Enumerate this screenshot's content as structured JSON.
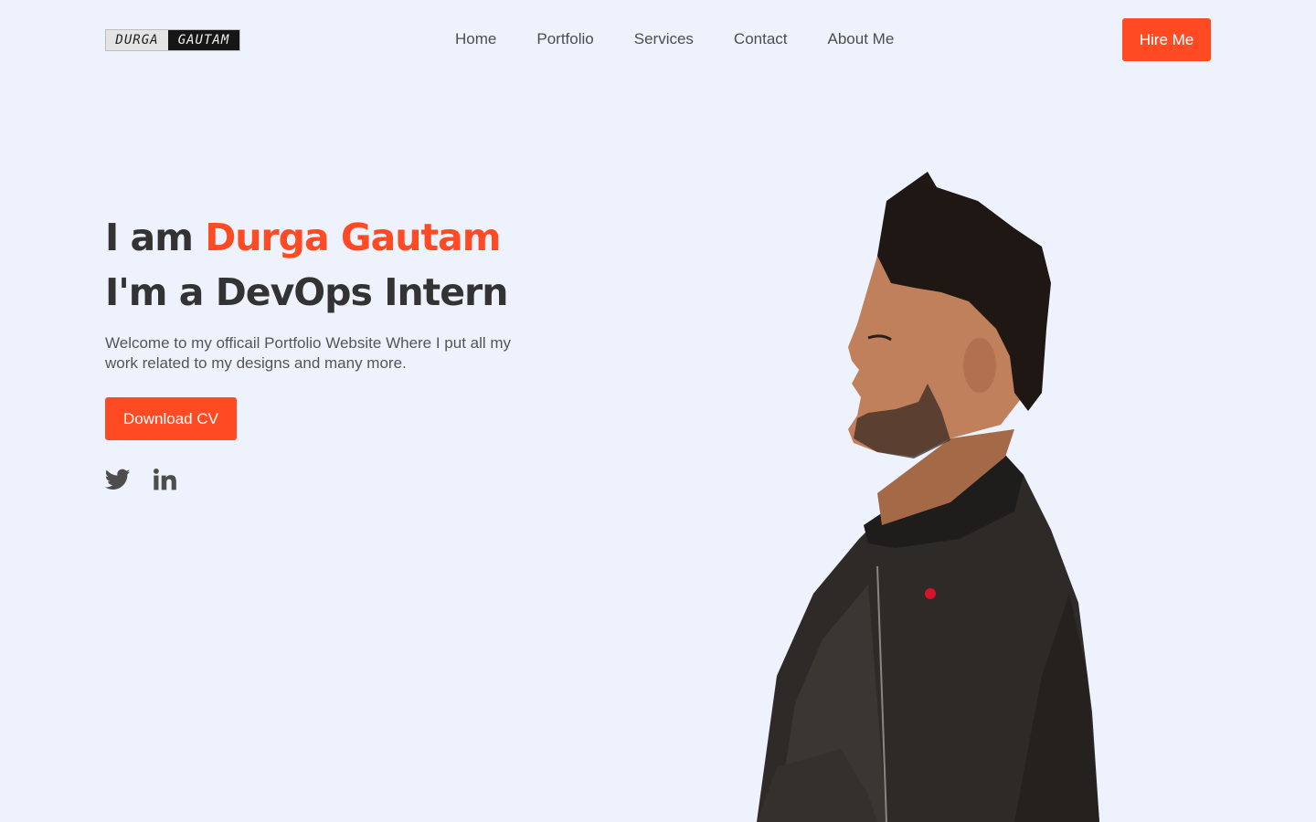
{
  "header": {
    "logo": {
      "left": "DURGA",
      "right": "GAUTAM"
    },
    "nav": [
      "Home",
      "Portfolio",
      "Services",
      "Contact",
      "About Me"
    ],
    "hire_label": "Hire Me"
  },
  "hero": {
    "greeting": "I am",
    "name": "Durga Gautam",
    "role": "I'm a DevOps Intern",
    "description": "Welcome to my officail Portfolio Website Where I put all my work related to my designs and many more.",
    "cv_label": "Download CV",
    "socials": [
      {
        "icon": "twitter-icon"
      },
      {
        "icon": "linkedin-icon"
      }
    ]
  },
  "colors": {
    "accent": "#ff4a23",
    "background": "#edf2fc",
    "heading": "#333333",
    "text": "#555555"
  }
}
